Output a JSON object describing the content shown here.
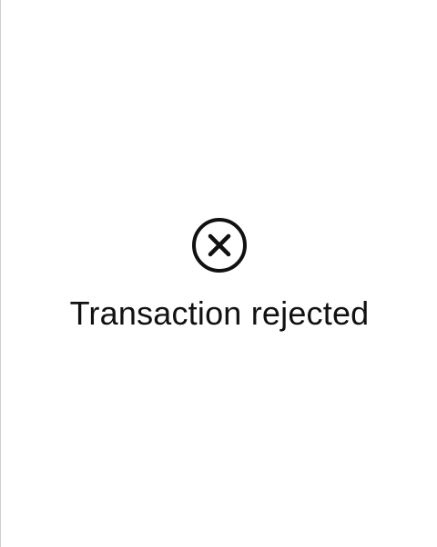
{
  "status": {
    "icon": "close-circle-icon",
    "message": "Transaction rejected",
    "color": "#111111"
  }
}
